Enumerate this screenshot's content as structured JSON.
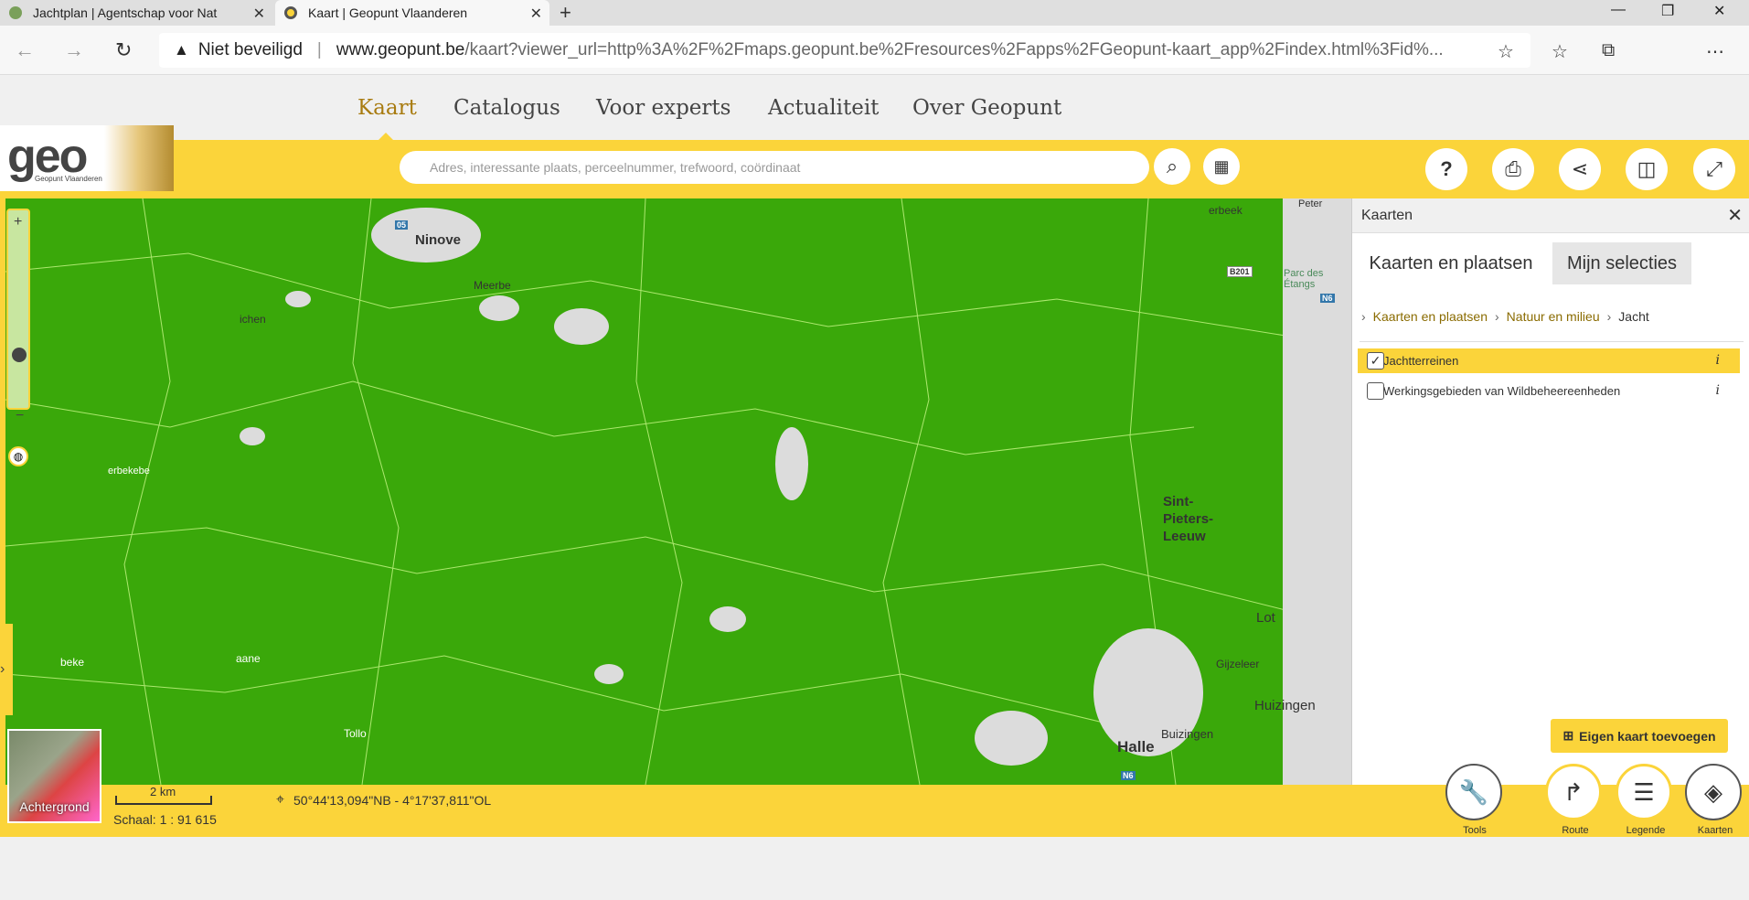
{
  "browser": {
    "tabs": [
      {
        "title": "Jachtplan | Agentschap voor Nat"
      },
      {
        "title": "Kaart | Geopunt Vlaanderen"
      }
    ],
    "security_label": "Niet beveiligd",
    "url_domain": "www.geopunt.be",
    "url_rest": "/kaart?viewer_url=http%3A%2F%2Fmaps.geopunt.be%2Fresources%2Fapps%2FGeopunt-kaart_app%2Findex.html%3Fid%..."
  },
  "site_nav": [
    "Kaart",
    "Catalogus",
    "Voor experts",
    "Actualiteit",
    "Over Geopunt"
  ],
  "logo": {
    "text": "geo",
    "subtitle": "Geopunt Vlaanderen"
  },
  "search": {
    "placeholder": "Adres, interessante plaats, perceelnummer, trefwoord, coördinaat"
  },
  "map": {
    "place_labels": [
      "Ninove",
      "Meerbe",
      "ichen",
      "Sint-Pieters-Leeuw",
      "Lot",
      "Huizingen",
      "Halle",
      "Buizingen",
      "Gijzeleer",
      "erbeek",
      "Parc des Étangs",
      "Peter",
      "erbekebe",
      "beke",
      "aane",
      "Tollo"
    ],
    "road_labels": [
      "B201",
      "N6",
      "N6",
      "05"
    ]
  },
  "panel": {
    "title": "Kaarten",
    "tabs": [
      "Kaarten en plaatsen",
      "Mijn selecties"
    ],
    "breadcrumb": [
      "Kaarten en plaatsen",
      "Natuur en milieu",
      "Jacht"
    ],
    "layers": [
      {
        "label": "Jachtterreinen",
        "checked": true
      },
      {
        "label": "Werkingsgebieden van Wildbeheereenheden",
        "checked": false
      }
    ],
    "add_button": "Eigen kaart toevoegen"
  },
  "bottom": {
    "background_label": "Achtergrond",
    "scale_distance": "2 km",
    "scale_text": "Schaal: 1 : 91 615",
    "coordinates": "50°44'13,094\"NB - 4°17'37,811\"OL",
    "buttons": [
      "Tools",
      "Route",
      "Legende",
      "Kaarten"
    ]
  },
  "colors": {
    "accent": "#fbd43a",
    "map_green": "#3aa80a",
    "link": "#8a6b00"
  }
}
